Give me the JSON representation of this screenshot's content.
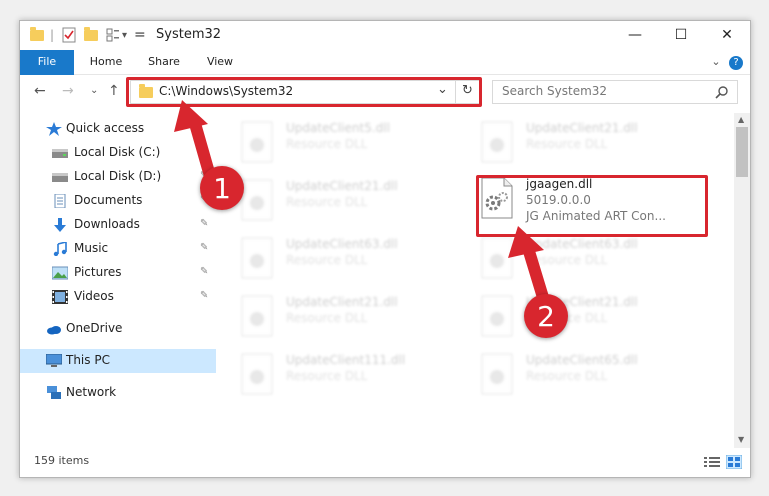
{
  "window": {
    "title": "System32",
    "minimize_glyph": "—",
    "maximize_glyph": "☐",
    "close_glyph": "✕",
    "qa_dropdown_glyph": "▾",
    "ribbon_expand_glyph": "⌄",
    "help_glyph": "?"
  },
  "ribbon": {
    "tabs": [
      "File",
      "Home",
      "Share",
      "View"
    ]
  },
  "address": {
    "path": "C:\\Windows\\System32",
    "dropdown_glyph": "⌄",
    "refresh_glyph": "↻",
    "back_glyph": "←",
    "forward_glyph": "→",
    "recent_glyph": "⌄",
    "up_glyph": "↑"
  },
  "search": {
    "placeholder": "Search System32",
    "icon": "search-icon"
  },
  "sidebar": {
    "items": [
      {
        "label": "Quick access",
        "icon": "star-icon"
      },
      {
        "label": "Local Disk (C:)",
        "icon": "drive-icon",
        "pinned": true
      },
      {
        "label": "Local Disk (D:)",
        "icon": "drive-icon",
        "pinned": true
      },
      {
        "label": "Documents",
        "icon": "documents-icon",
        "pinned": true
      },
      {
        "label": "Downloads",
        "icon": "download-icon",
        "pinned": true
      },
      {
        "label": "Music",
        "icon": "music-icon",
        "pinned": true
      },
      {
        "label": "Pictures",
        "icon": "pictures-icon",
        "pinned": true
      },
      {
        "label": "Videos",
        "icon": "video-icon",
        "pinned": true
      },
      {
        "label": "OneDrive",
        "icon": "cloud-icon"
      },
      {
        "label": "This PC",
        "icon": "computer-icon",
        "selected": true
      },
      {
        "label": "Network",
        "icon": "network-icon"
      }
    ],
    "pin_glyph": "📌"
  },
  "files": {
    "left": [
      {
        "name": "UpdateClient5.dll",
        "type": "Resource DLL"
      },
      {
        "name": "UpdateClient21.dll",
        "type": "Resource DLL"
      },
      {
        "name": "UpdateClient63.dll",
        "type": "Resource DLL"
      },
      {
        "name": "UpdateClient21.dll",
        "type": "Resource DLL"
      },
      {
        "name": "UpdateClient111.dll",
        "type": "Resource DLL"
      }
    ],
    "right": [
      {
        "name": "UpdateClient21.dll",
        "type": "Resource DLL"
      },
      {
        "name": "UpdateClient63.dll",
        "type": "Resource DLL"
      },
      {
        "name": "UpdateClient21.dll",
        "type": "Resource DLL"
      },
      {
        "name": "UpdateClient65.dll",
        "type": "Resource DLL"
      }
    ],
    "highlighted": {
      "name": "jgaagen.dll",
      "version": "5019.0.0.0",
      "description": "JG Animated ART Con..."
    }
  },
  "status": {
    "item_count": "159 items"
  },
  "annotations": {
    "step1": "1",
    "step2": "2",
    "color": "#d8262e"
  }
}
